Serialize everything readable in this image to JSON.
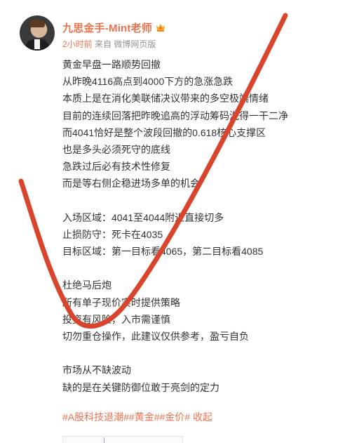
{
  "user": {
    "name": "九思金手-Mint老师",
    "badge_icon": "crown-icon"
  },
  "meta": {
    "time": "2小时前",
    "source": "来自 微博网页版"
  },
  "content": {
    "lines": [
      "黄金早盘一路顺势回撤",
      "从昨晚4116高点到4000下方的急涨急跌",
      "本质上是在消化美联储决议带来的多空极端情绪",
      "目前的连续回落把昨晚追高的浮动筹码洗得一干二净",
      "而4041恰好是整个波段回撤的0.618核心支撑区",
      "也是多头必须死守的底线",
      "急跌过后必有技术性修复",
      "而是等右侧企稳进场多单的机会",
      "",
      "入场区域：4041至4044附近直接切多",
      "止损防守：死卡在4035",
      "目标区域：第一目标看4065，第二目标看4085",
      "",
      "杜绝马后炮",
      "所有单子现价实时提供策略",
      "投资有风险，入市需谨慎",
      "切勿重仓操作，此建议仅供参考，盈亏自负",
      "",
      "市场从不缺波动",
      "缺的是在关键防御位敢于亮剑的定力"
    ]
  },
  "tags": "#A股科技退潮##黄金##金价# 收起",
  "colors": {
    "accent": "#eb7350",
    "annotation_stroke": "#d9452c"
  }
}
